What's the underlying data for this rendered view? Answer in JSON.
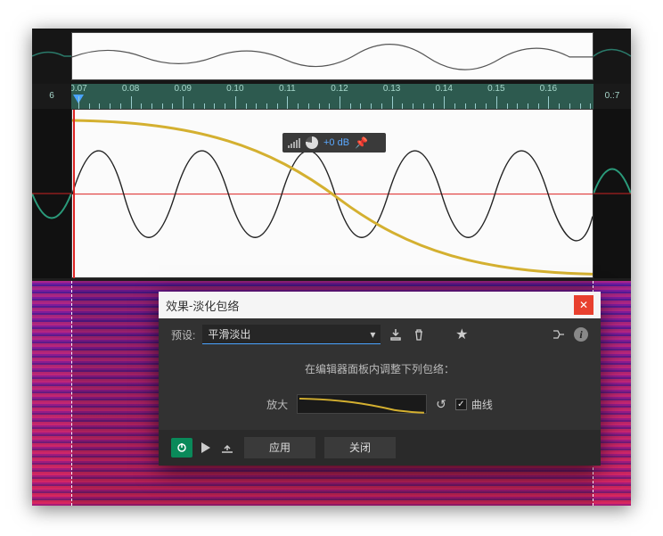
{
  "ruler": {
    "ticks": [
      "0.07",
      "0.08",
      "0.09",
      "0.10",
      "0.11",
      "0.12",
      "0.13",
      "0.14",
      "0.15",
      "0.16"
    ],
    "left_label": "6",
    "right_label": "0.:7"
  },
  "hud": {
    "db_text": "+0 dB"
  },
  "dialog": {
    "title_prefix": "效果",
    "title_sep": " - ",
    "title_name": "淡化包络",
    "preset_label": "预设:",
    "preset_value": "平滑淡出",
    "message": "在编辑器面板内调整下列包络：",
    "amp_label": "放大",
    "curve_label": "曲线",
    "apply": "应用",
    "close": "关闭"
  },
  "colors": {
    "accent": "#4aa3ff",
    "envelope": "#d4b030",
    "playhead": "#e22",
    "power": "#0a8a5a",
    "close_btn": "#e8402e"
  }
}
